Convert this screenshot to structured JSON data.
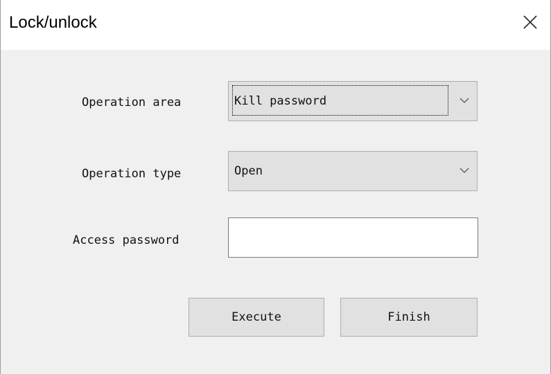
{
  "window": {
    "title": "Lock/unlock"
  },
  "form": {
    "operation_area": {
      "label": "Operation area",
      "selected": "Kill password"
    },
    "operation_type": {
      "label": "Operation type",
      "selected": "Open"
    },
    "access_password": {
      "label": "Access password",
      "value": "",
      "placeholder": ""
    }
  },
  "buttons": {
    "execute_label": "Execute",
    "finish_label": "Finish"
  },
  "icons": {
    "close": "close-icon",
    "dropdown": "chevron-down-icon"
  },
  "colors": {
    "dialog_bg": "#f0f0f0",
    "control_bg": "#e1e1e1",
    "control_border": "#adadad"
  }
}
